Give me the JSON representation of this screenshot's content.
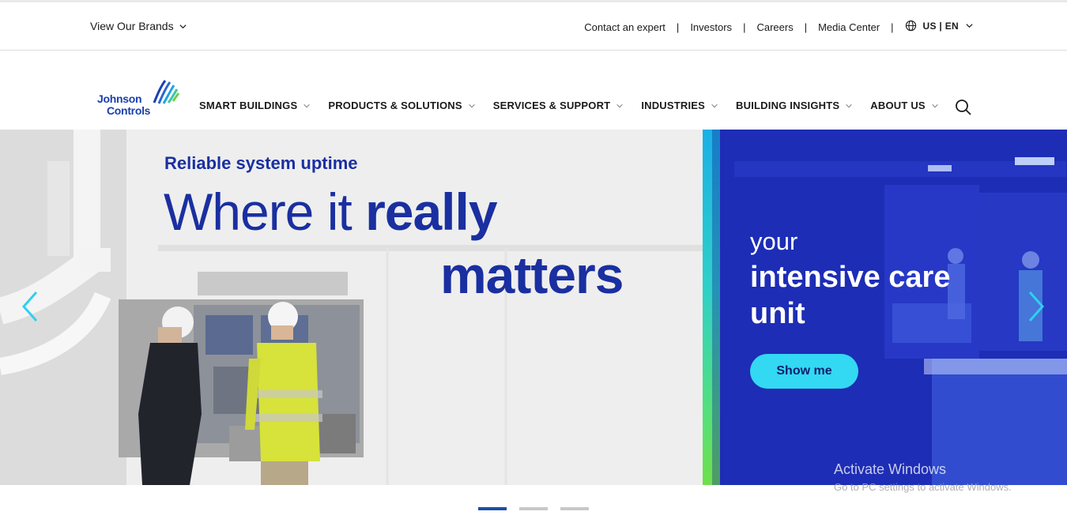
{
  "utility": {
    "brands_label": "View Our Brands",
    "links": [
      "Contact an expert",
      "Investors",
      "Careers",
      "Media Center"
    ],
    "separator": "|",
    "locale": "US | EN"
  },
  "logo": {
    "line1": "Johnson",
    "line2": "Controls"
  },
  "nav": {
    "items": [
      {
        "label": "SMART BUILDINGS"
      },
      {
        "label": "PRODUCTS & SOLUTIONS"
      },
      {
        "label": "SERVICES & SUPPORT"
      },
      {
        "label": "INDUSTRIES"
      },
      {
        "label": "BUILDING INSIGHTS"
      },
      {
        "label": "ABOUT US"
      }
    ],
    "search_icon": "search-icon"
  },
  "hero": {
    "kicker": "Reliable system uptime",
    "line1_light": "Where it ",
    "line1_bold": "really",
    "line2": "matters"
  },
  "promo": {
    "your": "your",
    "title": "intensive care unit",
    "cta": "Show me"
  },
  "watermark": {
    "title": "Activate Windows",
    "subtitle": "Go to PC settings to activate Windows."
  },
  "carousel": {
    "slide_count": 3,
    "active_index": 0
  },
  "colors": {
    "brand_blue": "#1a2fa0",
    "cta_cyan": "#33d8f2",
    "promo_bg": "#1b2bb2",
    "dot_active": "#1a4fa8"
  }
}
